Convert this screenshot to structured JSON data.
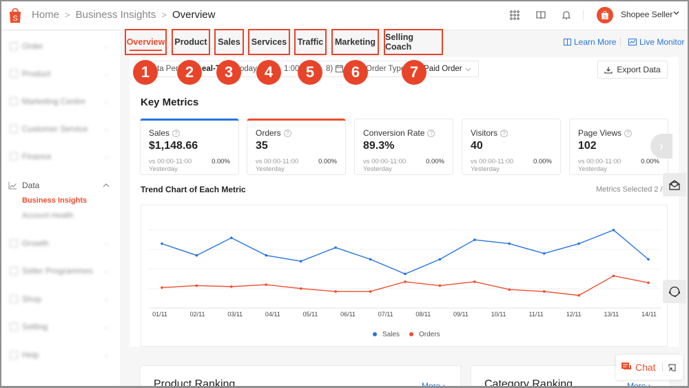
{
  "header": {
    "breadcrumb": [
      "Home",
      "Business Insights",
      "Overview"
    ],
    "user_name": "Shopee Seller",
    "icons": [
      "apps-grid-icon",
      "book-icon",
      "bell-icon"
    ]
  },
  "colors": {
    "brand": "#ee4d2d",
    "link": "#2673dd",
    "annotation": "#e8442a",
    "sales_series": "#2673dd",
    "orders_series": "#ee4d2d"
  },
  "sidebar": {
    "items": [
      {
        "label": "Order",
        "blurred": true
      },
      {
        "label": "Product",
        "blurred": true
      },
      {
        "label": "Marketing Centre",
        "blurred": true
      },
      {
        "label": "Customer Service",
        "blurred": true
      },
      {
        "label": "Finance",
        "blurred": true
      },
      {
        "label": "Data",
        "blurred": false,
        "expanded": true,
        "children": [
          {
            "label": "Business Insights",
            "active": true,
            "blurred": false
          },
          {
            "label": "Account Health",
            "blurred": true
          }
        ]
      },
      {
        "label": "Growth",
        "blurred": true
      },
      {
        "label": "Seller Programmes",
        "blurred": true
      },
      {
        "label": "Shop",
        "blurred": true
      },
      {
        "label": "Setting",
        "blurred": true
      },
      {
        "label": "Help",
        "blurred": true
      }
    ]
  },
  "tabs": [
    {
      "label": "Overview",
      "active": true,
      "badge": "1"
    },
    {
      "label": "Product",
      "badge": "2"
    },
    {
      "label": "Sales",
      "badge": "3"
    },
    {
      "label": "Services",
      "badge": "4"
    },
    {
      "label": "Traffic",
      "badge": "5"
    },
    {
      "label": "Marketing",
      "badge": "6"
    },
    {
      "label": "Selling Coach",
      "badge": "7"
    }
  ],
  "top_links": {
    "learn_more": "Learn More",
    "live_monitor": "Live Monitor"
  },
  "filter": {
    "fragments": [
      "ta Perio",
      "eal-T",
      "oday",
      "1:00 (",
      "8)",
      "Order Type",
      "Paid Order"
    ]
  },
  "export_label": "Export Data",
  "key_metrics": {
    "title": "Key Metrics",
    "cards": [
      {
        "title": "Sales",
        "value": "$1,148.66",
        "vs_line1": "vs 00:00-11:00",
        "vs_line2": "Yesterday",
        "change": "0.00%",
        "selected": "blue"
      },
      {
        "title": "Orders",
        "value": "35",
        "vs_line1": "vs 00:00-11:00",
        "vs_line2": "Yesterday",
        "change": "0.00%",
        "selected": "orange"
      },
      {
        "title": "Conversion Rate",
        "value": "89.3%",
        "vs_line1": "vs 00:00-11:00",
        "vs_line2": "Yesterday",
        "change": "0.00%"
      },
      {
        "title": "Visitors",
        "value": "40",
        "vs_line1": "vs 00:00-11:00",
        "vs_line2": "Yesterday",
        "change": "0.00%"
      },
      {
        "title": "Page Views",
        "value": "102",
        "vs_line1": "vs 00:00-11:00",
        "vs_line2": "Yesterday",
        "change": "0.00%"
      }
    ]
  },
  "trend": {
    "title": "Trend Chart of Each Metric",
    "metrics_selected": "Metrics Selected 2 /"
  },
  "chart_data": {
    "type": "line",
    "title": "Trend Chart of Each Metric",
    "xlabel": "",
    "ylabel": "",
    "x_tick_labels": [
      "01/11",
      "02/11",
      "03/11",
      "04/11",
      "05/11",
      "06/11",
      "07/11",
      "08/11",
      "09/11",
      "10/11",
      "11/11",
      "12/11",
      "13/11",
      "14/11"
    ],
    "y_axis_labels_visible": false,
    "ylim": [
      0,
      5
    ],
    "grid": true,
    "legend_position": "bottom-center",
    "series": [
      {
        "name": "Sales",
        "color": "#2673dd",
        "values": [
          3.3,
          2.7,
          3.6,
          2.7,
          2.4,
          3.1,
          2.5,
          1.75,
          2.5,
          3.5,
          3.3,
          2.8,
          3.3,
          4.0,
          2.5
        ]
      },
      {
        "name": "Orders",
        "color": "#ee4d2d",
        "values": [
          1.05,
          1.15,
          1.1,
          1.2,
          1.0,
          0.85,
          0.85,
          1.35,
          1.15,
          1.35,
          0.95,
          0.85,
          0.65,
          1.65,
          1.3
        ]
      }
    ]
  },
  "rankings": [
    {
      "title": "Product Ranking",
      "more": "More"
    },
    {
      "title": "Category Ranking",
      "more": "More"
    }
  ],
  "chat_label": "Chat"
}
